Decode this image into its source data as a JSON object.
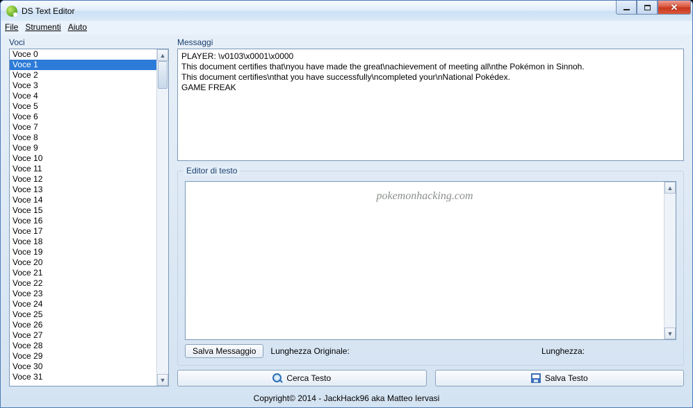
{
  "window": {
    "title": "DS Text Editor"
  },
  "menu": {
    "file": "File",
    "tools": "Strumenti",
    "help": "Aiuto"
  },
  "panels": {
    "voci_label": "Voci",
    "messaggi_label": "Messaggi",
    "editor_group": "Editor di testo"
  },
  "voci": {
    "selected_index": 1,
    "items": [
      "Voce 0",
      "Voce 1",
      "Voce 2",
      "Voce 3",
      "Voce 4",
      "Voce 5",
      "Voce 6",
      "Voce 7",
      "Voce 8",
      "Voce 9",
      "Voce 10",
      "Voce 11",
      "Voce 12",
      "Voce 13",
      "Voce 14",
      "Voce 15",
      "Voce 16",
      "Voce 17",
      "Voce 18",
      "Voce 19",
      "Voce 20",
      "Voce 21",
      "Voce 22",
      "Voce 23",
      "Voce 24",
      "Voce 25",
      "Voce 26",
      "Voce 27",
      "Voce 28",
      "Voce 29",
      "Voce 30",
      "Voce 31"
    ]
  },
  "messaggi": {
    "text": "PLAYER: \\v0103\\x0001\\x0000\nThis document certifies that\\nyou have made the great\\nachievement of meeting all\\nthe Pokémon in Sinnoh.\nThis document certifies\\nthat you have successfully\\ncompleted your\\nNational Pokédex.\nGAME FREAK"
  },
  "editor": {
    "watermark": "pokemonhacking.com",
    "btn_save_msg": "Salva Messaggio",
    "len_orig_label": "Lunghezza Originale:",
    "len_orig_value": "",
    "len_label": "Lunghezza:",
    "len_value": ""
  },
  "buttons": {
    "search": "Cerca Testo",
    "save": "Salva Testo"
  },
  "footer": {
    "copyright": "Copyright© 2014 - JackHack96 aka Matteo Iervasi"
  }
}
